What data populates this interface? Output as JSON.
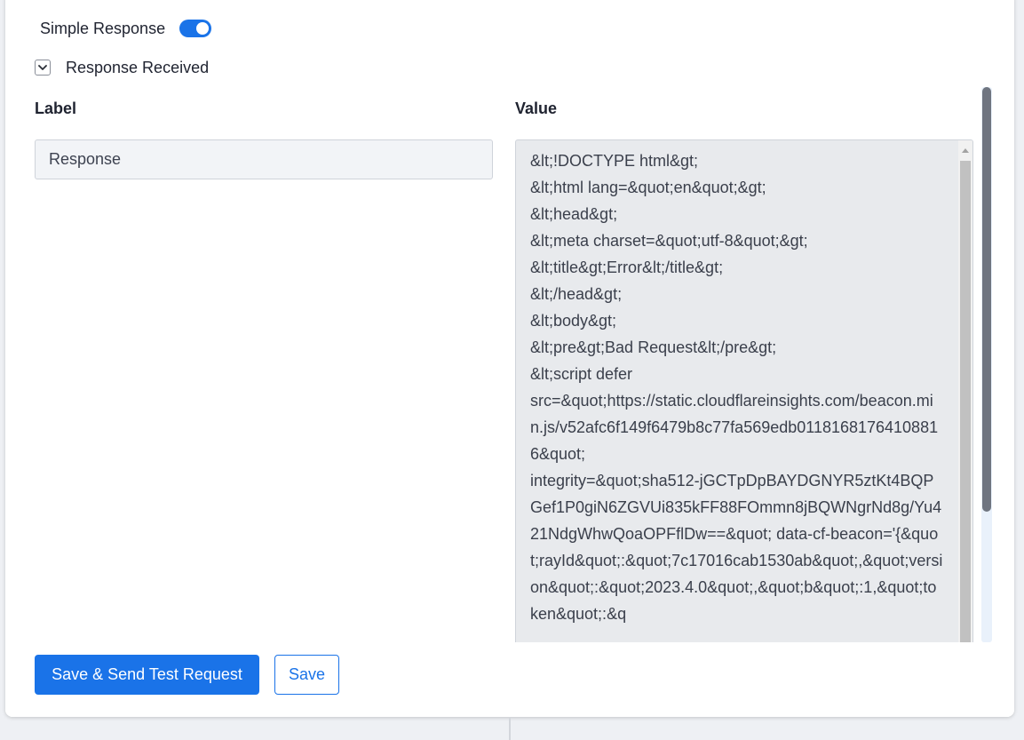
{
  "simple_response": {
    "label": "Simple Response",
    "enabled": true
  },
  "response_received": {
    "label": "Response Received",
    "expanded": true,
    "icon": "chevron-down-icon"
  },
  "columns": {
    "label_header": "Label",
    "value_header": "Value"
  },
  "row": {
    "label": "Response",
    "value": "&lt;!DOCTYPE html&gt;\n&lt;html lang=&quot;en&quot;&gt;\n&lt;head&gt;\n&lt;meta charset=&quot;utf-8&quot;&gt;\n&lt;title&gt;Error&lt;/title&gt;\n&lt;/head&gt;\n&lt;body&gt;\n&lt;pre&gt;Bad Request&lt;/pre&gt;\n&lt;script defer\nsrc=&quot;https://static.cloudflareinsights.com/beacon.min.js/v52afc6f149f6479b8c77fa569edb01181681764108816&quot;\nintegrity=&quot;sha512-jGCTpDpBAYDGNYR5ztKt4BQPGef1P0giN6ZGVUi835kFF88FOmmn8jBQWNgrNd8g/Yu421NdgWhwQoaOPFflDw==&quot; data-cf-beacon='{&quot;rayId&quot;:&quot;7c17016cab1530ab&quot;,&quot;version&quot;:&quot;2023.4.0&quot;,&quot;b&quot;:1,&quot;token&quot;:&q"
  },
  "buttons": {
    "save_and_send": "Save & Send Test Request",
    "save": "Save"
  },
  "colors": {
    "accent": "#1a73e8",
    "value_bg": "#e8eaed",
    "label_bg": "#f2f4f7"
  }
}
